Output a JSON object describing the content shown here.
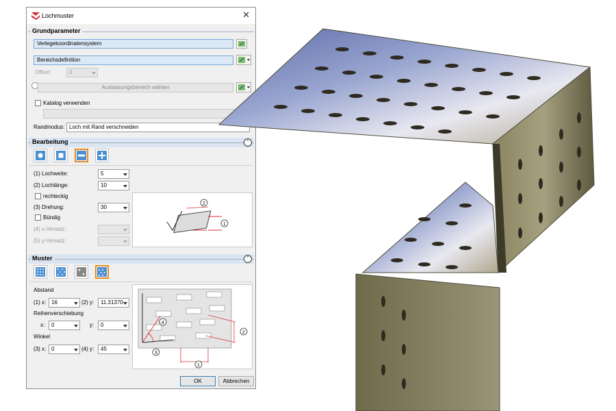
{
  "window": {
    "title": "Lochmuster"
  },
  "grundparameter": {
    "heading": "Grundparameter",
    "verlege_field": "Verlegekoordinatensystem",
    "bereich_field": "Bereichsdefinition",
    "offset_label": "Offset:",
    "offset_value": "0",
    "auslassung_field": "Auslassungsbereich wählen",
    "katalog_label": "Katalog verwenden",
    "randmodus_label": "Randmodus:",
    "randmodus_value": "Loch mit Rand verschneiden"
  },
  "bearbeitung": {
    "heading": "Bearbeitung",
    "lochweite_label": "(1) Lochweite:",
    "lochweite_value": "5",
    "lochlaenge_label": "(2) Lochlänge:",
    "lochlaenge_value": "10",
    "rechteckig_label": "rechteckig",
    "drehung_label": "(3) Drehung:",
    "drehung_value": "30",
    "buendig_label": "Bündig",
    "xversatz_label": "(4) x-Versatz:",
    "yversatz_label": "(5) y-Versatz:",
    "diagram_marks": [
      "2",
      "1"
    ]
  },
  "muster": {
    "heading": "Muster",
    "abstand_label": "Abstand",
    "abstand_x_label": "(1) x:",
    "abstand_x_value": "16",
    "abstand_y_label": "(2) y:",
    "abstand_y_value": "11.31370",
    "reihen_label": "Reihenverschiebung",
    "reihen_x_label": "x:",
    "reihen_x_value": "0",
    "reihen_y_label": "y:",
    "reihen_y_value": "0",
    "winkel_label": "Winkel",
    "winkel_x_label": "(3) x:",
    "winkel_x_value": "0",
    "winkel_y_label": "(4) y:",
    "winkel_y_value": "45",
    "diagram_marks": [
      "4",
      "2",
      "3",
      "1"
    ]
  },
  "buttons": {
    "ok": "OK",
    "cancel": "Abbrechen"
  },
  "colors": {
    "accent": "#e88a1e",
    "icon_blue": "#4a8fd4",
    "field_blue": "#dbe9f7"
  }
}
